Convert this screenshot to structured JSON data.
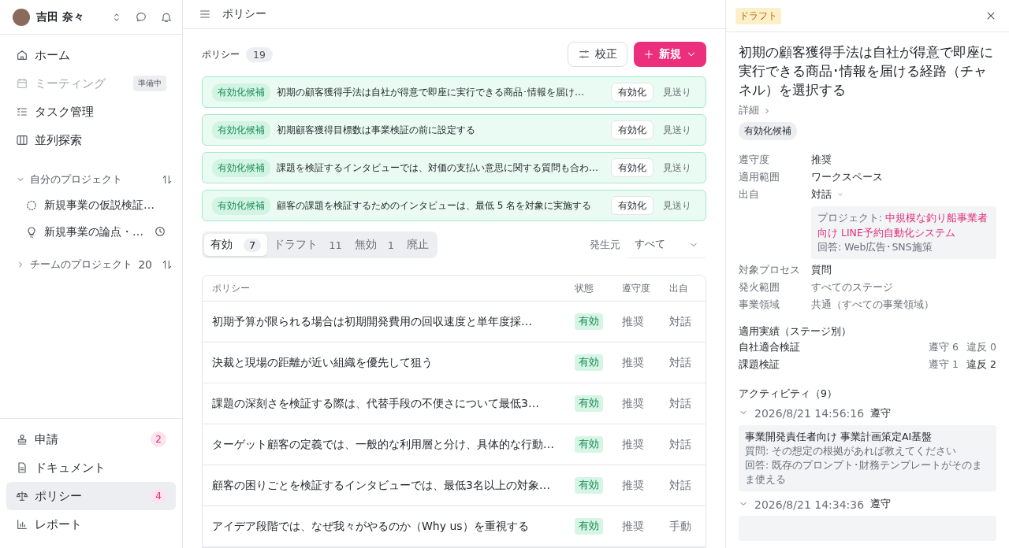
{
  "user": {
    "name": "吉田 奈々"
  },
  "nav": [
    {
      "label": "ホーム",
      "kind": "home",
      "disabled": false
    },
    {
      "label": "ミーティング",
      "kind": "calendar",
      "disabled": true,
      "badge": "準備中"
    },
    {
      "label": "タスク管理",
      "kind": "tasks",
      "disabled": false
    },
    {
      "label": "並列探索",
      "kind": "columns",
      "disabled": false
    }
  ],
  "my_projects": {
    "label": "自分のプロジェクト",
    "expanded": true,
    "items": [
      {
        "name": "新規事業の仮説検証…",
        "kind": "pending",
        "clock": false
      },
      {
        "name": "新規事業の論点・…",
        "kind": "idea",
        "clock": true
      }
    ]
  },
  "team_projects": {
    "label": "チームのプロジェクト",
    "count": "20",
    "expanded": false
  },
  "bottom_nav": [
    {
      "label": "申請",
      "kind": "stamp",
      "count": "2",
      "selected": false
    },
    {
      "label": "ドキュメント",
      "kind": "doc",
      "selected": false
    },
    {
      "label": "ポリシー",
      "kind": "scale",
      "count": "4",
      "selected": true
    },
    {
      "label": "レポート",
      "kind": "chart",
      "selected": false
    }
  ],
  "topbar": {
    "title": "ポリシー"
  },
  "header": {
    "title": "ポリシー",
    "count": "19",
    "calibrate_button": "校正",
    "new_button": "新規"
  },
  "candidates": [
    {
      "tag": "有効化候補",
      "text": "初期の顧客獲得手法は自社が得意で即座に実行できる商品･情報を届け…",
      "activate": "有効化",
      "skip": "見送り"
    },
    {
      "tag": "有効化候補",
      "text": "初期顧客獲得目標数は事業検証の前に設定する",
      "activate": "有効化",
      "skip": "見送り"
    },
    {
      "tag": "有効化候補",
      "text": "課題を検証するインタビューでは、対価の支払い意思に関する質問も合わ…",
      "activate": "有効化",
      "skip": "見送り"
    },
    {
      "tag": "有効化候補",
      "text": "顧客の課題を検証するためのインタビューは、最低 5 名を対象に実施する",
      "activate": "有効化",
      "skip": "見送り"
    }
  ],
  "tabs": [
    {
      "label": "有効",
      "count": "7",
      "selected": true
    },
    {
      "label": "ドラフト",
      "count": "11",
      "selected": false
    },
    {
      "label": "無効",
      "count": "1",
      "selected": false
    },
    {
      "label": "廃止",
      "selected": false
    }
  ],
  "filter": {
    "label": "発生元",
    "value": "すべて"
  },
  "table": {
    "columns": [
      "ポリシー",
      "状態",
      "遵守度",
      "出自"
    ],
    "rows": [
      {
        "policy": "初期予算が限られる場合は初期開発費用の回収速度と単年度採…",
        "status": "有効",
        "compliance": "推奨",
        "origin": "対話"
      },
      {
        "policy": "決裁と現場の距離が近い組織を優先して狙う",
        "status": "有効",
        "compliance": "推奨",
        "origin": "対話"
      },
      {
        "policy": "課題の深刻さを検証する際は、代替手段の不便さについて最低3…",
        "status": "有効",
        "compliance": "推奨",
        "origin": "対話"
      },
      {
        "policy": "ターゲット顧客の定義では、一般的な利用層と分け、具体的な行動…",
        "status": "有効",
        "compliance": "推奨",
        "origin": "対話"
      },
      {
        "policy": "顧客の困りごとを検証するインタビューでは、最低3名以上の対象…",
        "status": "有効",
        "compliance": "推奨",
        "origin": "対話"
      },
      {
        "policy": "アイデア段階では、なぜ我々がやるのか（Why us）を重視する",
        "status": "有効",
        "compliance": "推奨",
        "origin": "手動"
      }
    ]
  },
  "detail": {
    "status": "ドラフト",
    "title": "初期の顧客獲得手法は自社が得意で即座に実行できる商品･情報を届ける経路（チャネル）を選択する",
    "details_link": "詳細",
    "tag": "有効化候補",
    "properties": [
      {
        "label": "遵守度",
        "value": "推奨",
        "muted": false,
        "kind": "plain"
      },
      {
        "label": "適用範囲",
        "value": "ワークスペース",
        "muted": false,
        "kind": "plain"
      },
      {
        "label": "出自",
        "value": "対話",
        "muted": false,
        "kind": "dropdown"
      }
    ],
    "source": {
      "project_label": "プロジェクト:",
      "project": "中規模な釣り船事業者向け LINE予約自動化システム",
      "answer": "回答: Web広告･SNS施策"
    },
    "properties_2": [
      {
        "label": "対象プロセス",
        "value": "質問",
        "muted": false
      },
      {
        "label": "発火範囲",
        "value": "すべてのステージ",
        "muted": true
      },
      {
        "label": "事業領域",
        "value": "共通（すべての事業領域）",
        "muted": true
      }
    ],
    "stats": {
      "title": "適用実績（ステージ別）",
      "rows": [
        {
          "stage": "自社適合検証",
          "comply": "遵守 6",
          "violate": "違反 0",
          "alert": false
        },
        {
          "stage": "課題検証",
          "comply": "遵守 1",
          "violate": "違反 2",
          "alert": true
        }
      ]
    },
    "activity": {
      "title": "アクティビティ（9）",
      "entries": [
        {
          "time": "2026/8/21 14:56:16",
          "result": "遵守",
          "expanded": true,
          "project": "事業開発責任者向け 事業計画策定AI基盤",
          "question": "質問: その想定の根拠があれば教えてください",
          "answer": "回答: 既存のプロンプト･財務テンプレートがそのまま使える"
        },
        {
          "time": "2026/8/21 14:34:36",
          "result": "遵守",
          "expanded": true
        }
      ]
    }
  }
}
